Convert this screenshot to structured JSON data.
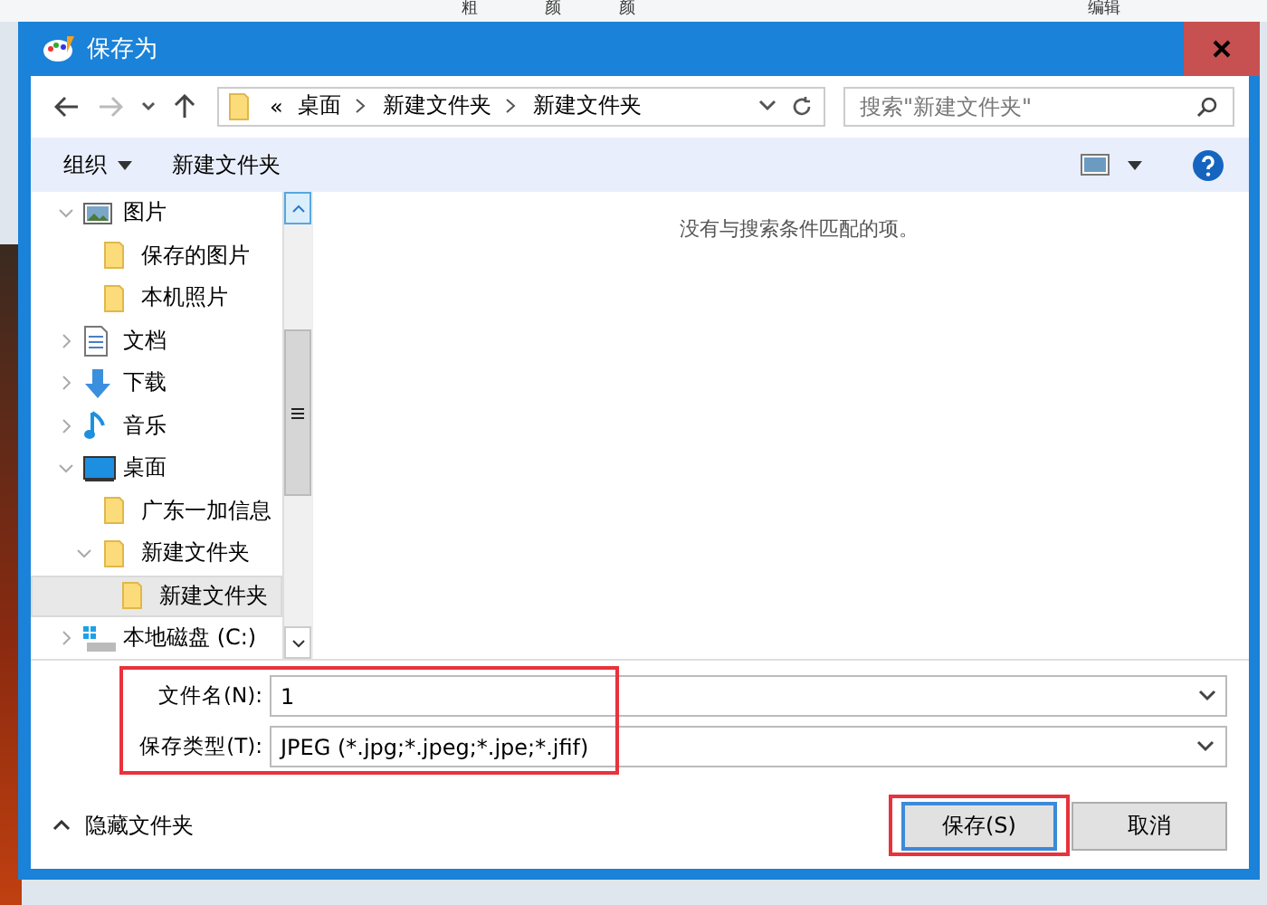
{
  "background_app": {
    "toolbar_labels": [
      "粗",
      "颜",
      "颜",
      "编辑"
    ]
  },
  "window": {
    "title": "保存为"
  },
  "address_bar": {
    "overflow": "«",
    "path": [
      "桌面",
      "新建文件夹",
      "新建文件夹"
    ]
  },
  "search": {
    "placeholder": "搜索\"新建文件夹\""
  },
  "toolbar": {
    "organize": "组织",
    "new_folder": "新建文件夹"
  },
  "tree": [
    {
      "label": "图片",
      "kind": "pictures",
      "expanded": true,
      "selected": false,
      "children": [
        {
          "label": "保存的图片",
          "kind": "folder",
          "selected": false
        },
        {
          "label": "本机照片",
          "kind": "folder",
          "selected": false
        }
      ]
    },
    {
      "label": "文档",
      "kind": "document",
      "expanded": false,
      "selected": false
    },
    {
      "label": "下载",
      "kind": "download",
      "expanded": false,
      "selected": false
    },
    {
      "label": "音乐",
      "kind": "music",
      "expanded": false,
      "selected": false
    },
    {
      "label": "桌面",
      "kind": "desktop",
      "expanded": true,
      "selected": false,
      "children": [
        {
          "label": "广东一加信息",
          "kind": "folder",
          "selected": false
        },
        {
          "label": "新建文件夹",
          "kind": "folder",
          "expanded": true,
          "selected": false,
          "children": [
            {
              "label": "新建文件夹",
              "kind": "folder",
              "selected": true
            }
          ]
        }
      ]
    },
    {
      "label": "本地磁盘 (C:)",
      "kind": "drive",
      "expanded": false,
      "selected": false
    }
  ],
  "content": {
    "empty_message": "没有与搜索条件匹配的项。"
  },
  "form": {
    "filename_label": "文件名(N):",
    "filename": "1",
    "type_label": "保存类型(T):",
    "type": "JPEG (*.jpg;*.jpeg;*.jpe;*.jfif)"
  },
  "footer": {
    "hide_folders": "隐藏文件夹",
    "save": "保存(S)",
    "cancel": "取消"
  }
}
